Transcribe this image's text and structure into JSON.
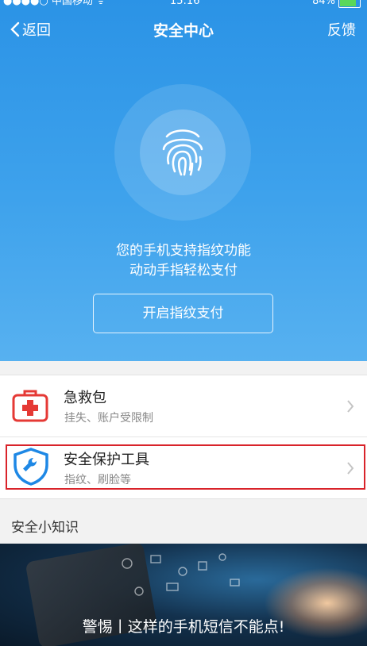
{
  "status_bar": {
    "carrier": "●●●●○ 中国移动 ᯤ",
    "time": "15:16",
    "battery": "84%"
  },
  "nav": {
    "back_label": "返回",
    "title": "安全中心",
    "feedback_label": "反馈"
  },
  "hero": {
    "line1": "您的手机支持指纹功能",
    "line2": "动动手指轻松支付",
    "button_label": "开启指纹支付"
  },
  "menu": {
    "items": [
      {
        "title": "急救包",
        "subtitle": "挂失、账户受限制",
        "icon": "first-aid-kit-icon"
      },
      {
        "title": "安全保护工具",
        "subtitle": "指纹、刷脸等",
        "icon": "shield-wrench-icon"
      }
    ]
  },
  "section_title": "安全小知识",
  "banner": {
    "caption": "警惕丨这样的手机短信不能点!"
  },
  "colors": {
    "hero": "#2b93e6",
    "highlight": "#d9232a",
    "kit_red": "#e53935",
    "shield_blue": "#1e88e5"
  }
}
